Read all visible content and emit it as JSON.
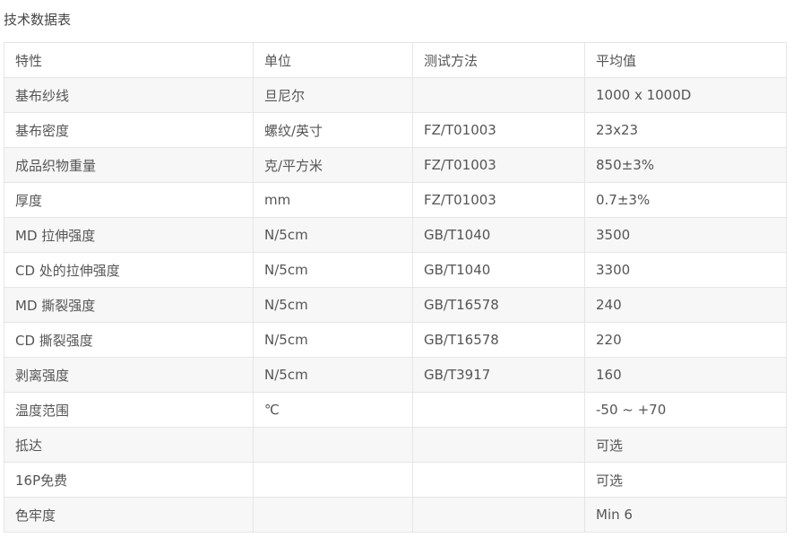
{
  "page": {
    "title": "技术数据表"
  },
  "colors": {
    "text": "#555555",
    "border": "#e5e5e5",
    "stripe": "#f7f7f7"
  },
  "table": {
    "headers": [
      "特性",
      "单位",
      "测试方法",
      "平均值"
    ],
    "rows": [
      [
        "基布纱线",
        "旦尼尔",
        "",
        "1000 x 1000D"
      ],
      [
        "基布密度",
        "螺纹/英寸",
        "FZ/T01003",
        "23x23"
      ],
      [
        "成品织物重量",
        "克/平方米",
        "FZ/T01003",
        "850±3%"
      ],
      [
        "厚度",
        "mm",
        "FZ/T01003",
        "0.7±3%"
      ],
      [
        "MD 拉伸强度",
        "N/5cm",
        "GB/T1040",
        "3500"
      ],
      [
        "CD 处的拉伸强度",
        "N/5cm",
        "GB/T1040",
        "3300"
      ],
      [
        "MD 撕裂强度",
        "N/5cm",
        "GB/T16578",
        "240"
      ],
      [
        "CD 撕裂强度",
        "N/5cm",
        "GB/T16578",
        "220"
      ],
      [
        "剥离强度",
        "N/5cm",
        "GB/T3917",
        "160"
      ],
      [
        "温度范围",
        "℃",
        "",
        "-50 ~ +70"
      ],
      [
        "抵达",
        "",
        "",
        "可选"
      ],
      [
        "16P免费",
        "",
        "",
        "可选"
      ],
      [
        "色牢度",
        "",
        "",
        "Min 6"
      ]
    ]
  }
}
